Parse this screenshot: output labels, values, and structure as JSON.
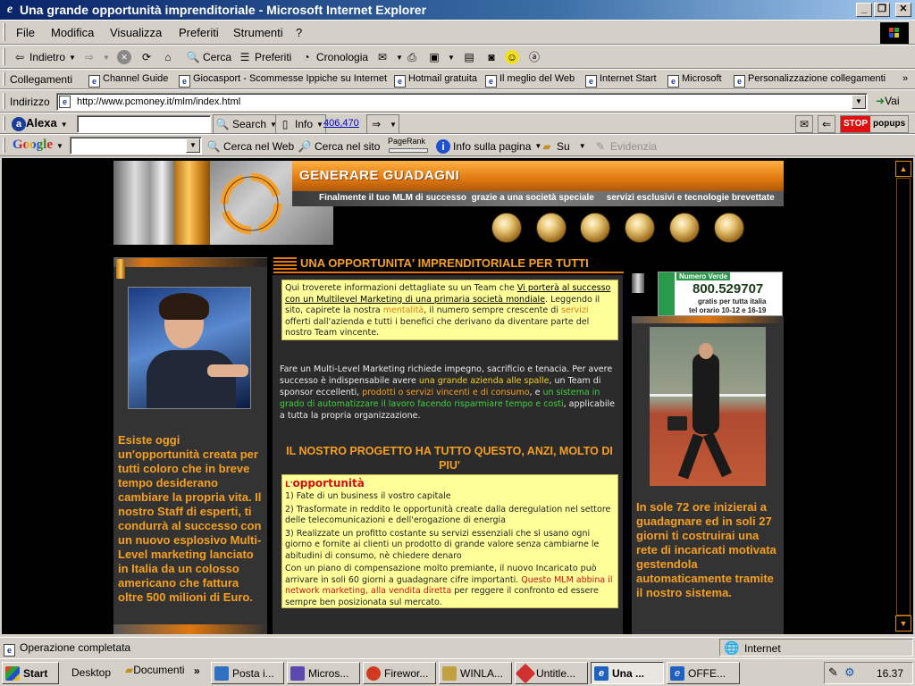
{
  "window": {
    "title": "Una grande opportunità imprenditoriale - Microsoft Internet Explorer"
  },
  "menu": [
    "File",
    "Modifica",
    "Visualizza",
    "Preferiti",
    "Strumenti",
    "?"
  ],
  "toolbar": {
    "back": "Indietro",
    "search": "Cerca",
    "favorites": "Preferiti",
    "history": "Cronologia"
  },
  "links": {
    "label": "Collegamenti",
    "items": [
      "Channel Guide",
      "Giocasport - Scommesse Ippiche su Internet",
      "Hotmail gratuita",
      "Il meglio del Web",
      "Internet Start",
      "Microsoft",
      "Personalizzazione collegamenti"
    ]
  },
  "address": {
    "label": "Indirizzo",
    "url": "http://www.pcmoney.it/mlm/index.html",
    "go": "Vai"
  },
  "alexa": {
    "brand": "Alexa",
    "search": "Search",
    "info": "Info",
    "rank": "406,470",
    "stop": "STOP",
    "popups": "popups"
  },
  "google": {
    "brand": "Google",
    "search_web": "Cerca nel Web",
    "search_site": "Cerca nel sito",
    "pagerank": "PageRank",
    "page_info": "Info sulla pagina",
    "up": "Su",
    "highlight": "Evidenzia"
  },
  "page": {
    "header_title": "GENERARE  GUADAGNI",
    "header_tagline": "Finalmente il tuo MLM di successo  grazie a una società speciale     servizi esclusivi e tecnologie brevettate",
    "main_heading": "UNA  OPPORTUNITA' IMPRENDITORIALE PER TUTTI",
    "intro": {
      "p1": "Qui troverete informazioni dettagliate su un Team che ",
      "link": "Vi porterà al successo con un Multilevel Marketing di una primaria società mondiale",
      "p2": ". Leggendo il sito, capirete  la nostra ",
      "h1": "mentalità",
      "p3": ",  il numero sempre crescente di ",
      "h2": "servizi",
      "p4": " offerti dall'azienda e tutti i benefici che derivano da diventare parte del nostro Team vincente."
    },
    "mlm": {
      "p1": "Fare un Multi-Level Marketing richiede impegno, sacrificio e tenacia.  Per avere successo è indispensabile avere ",
      "y1": "una grande azienda alle spalle",
      "p2": ", un Team di sponsor eccellenti,  ",
      "o1": "prodotti o servizi vincenti e di consumo",
      "p3": ", e ",
      "g1": "un sistema in grado di automatizzare il lavoro facendo risparmiare tempo e costi",
      "p4": ", applicabile a tutta la propria organizzazione."
    },
    "project_heading": "IL NOSTRO PROGETTO HA TUTTO QUESTO, ANZI, MOLTO DI PIU'",
    "opportunity": {
      "title_l": "L'",
      "title": "opportunità",
      "i1": "1) Fate di un business il vostro capitale",
      "i2": "2) Trasformate in reddito le opportunità create dalla deregulation nel settore delle telecomunicazioni e dell'erogazione di energia",
      "i3": "3) Realizzate un profitto costante su servizi essenziali che si usano ogni giorno e fornite ai clienti un prodotto di grande valore senza cambiarne le abitudini di consumo, nè chiedere denaro",
      "p1": "Con un piano di compensazione molto premiante, il nuovo Incaricato può arrivare in soli 60 giorni a guadagnare  cifre importanti. ",
      "r1": "Questo MLM abbina il network marketing, alla vendita diretta",
      "p2": " per reggere il confronto ed essere sempre ben posizionata sul mercato."
    },
    "left_text": "Esiste oggi un'opportunità creata per tutti coloro che in breve tempo desiderano cambiare la propria vita. Il nostro Staff di esperti, ti condurrà al successo con un nuovo esplosivo Multi-Level marketing lanciato in Italia da un colosso americano che fattura oltre 500 milioni di Euro.",
    "green": {
      "label": "Numero Verde",
      "number": "800.529707",
      "free": "gratis per tutta italia",
      "hours": "tel orario 10-12 e 16-19"
    },
    "right_text": "In sole 72 ore inizierai a guadagnare  ed in soli 27 giorni ti costruirai una rete di incaricati motivata gestendola automaticamente tramite il nostro sistema."
  },
  "status": {
    "text": "Operazione completata",
    "zone": "Internet"
  },
  "taskbar": {
    "start": "Start",
    "desktop": "Desktop",
    "documents": "Documenti",
    "tasks": [
      "Posta i...",
      "Micros...",
      "Firewor...",
      "WINLA...",
      "Untitle...",
      "Una ...",
      "OFFE..."
    ],
    "clock": "16.37"
  }
}
